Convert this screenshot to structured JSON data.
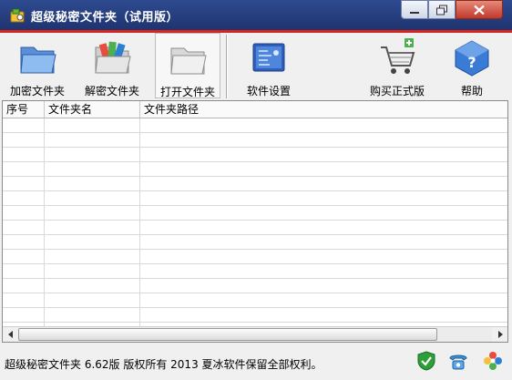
{
  "window": {
    "title": "超级秘密文件夹（试用版）"
  },
  "toolbar": {
    "buttons": [
      {
        "label": "加密文件夹",
        "icon": "encrypt-folder-icon"
      },
      {
        "label": "解密文件夹",
        "icon": "decrypt-folder-icon"
      },
      {
        "label": "打开文件夹",
        "icon": "open-folder-icon"
      },
      {
        "label": "软件设置",
        "icon": "settings-icon"
      },
      {
        "label": "购买正式版",
        "icon": "shopping-cart-icon"
      },
      {
        "label": "帮助",
        "icon": "help-icon"
      }
    ]
  },
  "table": {
    "columns": [
      "序号",
      "文件夹名",
      "文件夹路径"
    ],
    "rows": []
  },
  "status": {
    "text": "超级秘密文件夹 6.62版 版权所有 2013 夏冰软件保留全部权利。",
    "icons": [
      "shield-check-icon",
      "phone-icon",
      "flower-icon"
    ]
  },
  "colors": {
    "title_bar": "#1f3470",
    "accent_red": "#d9261c",
    "close_button": "#c0392b"
  }
}
